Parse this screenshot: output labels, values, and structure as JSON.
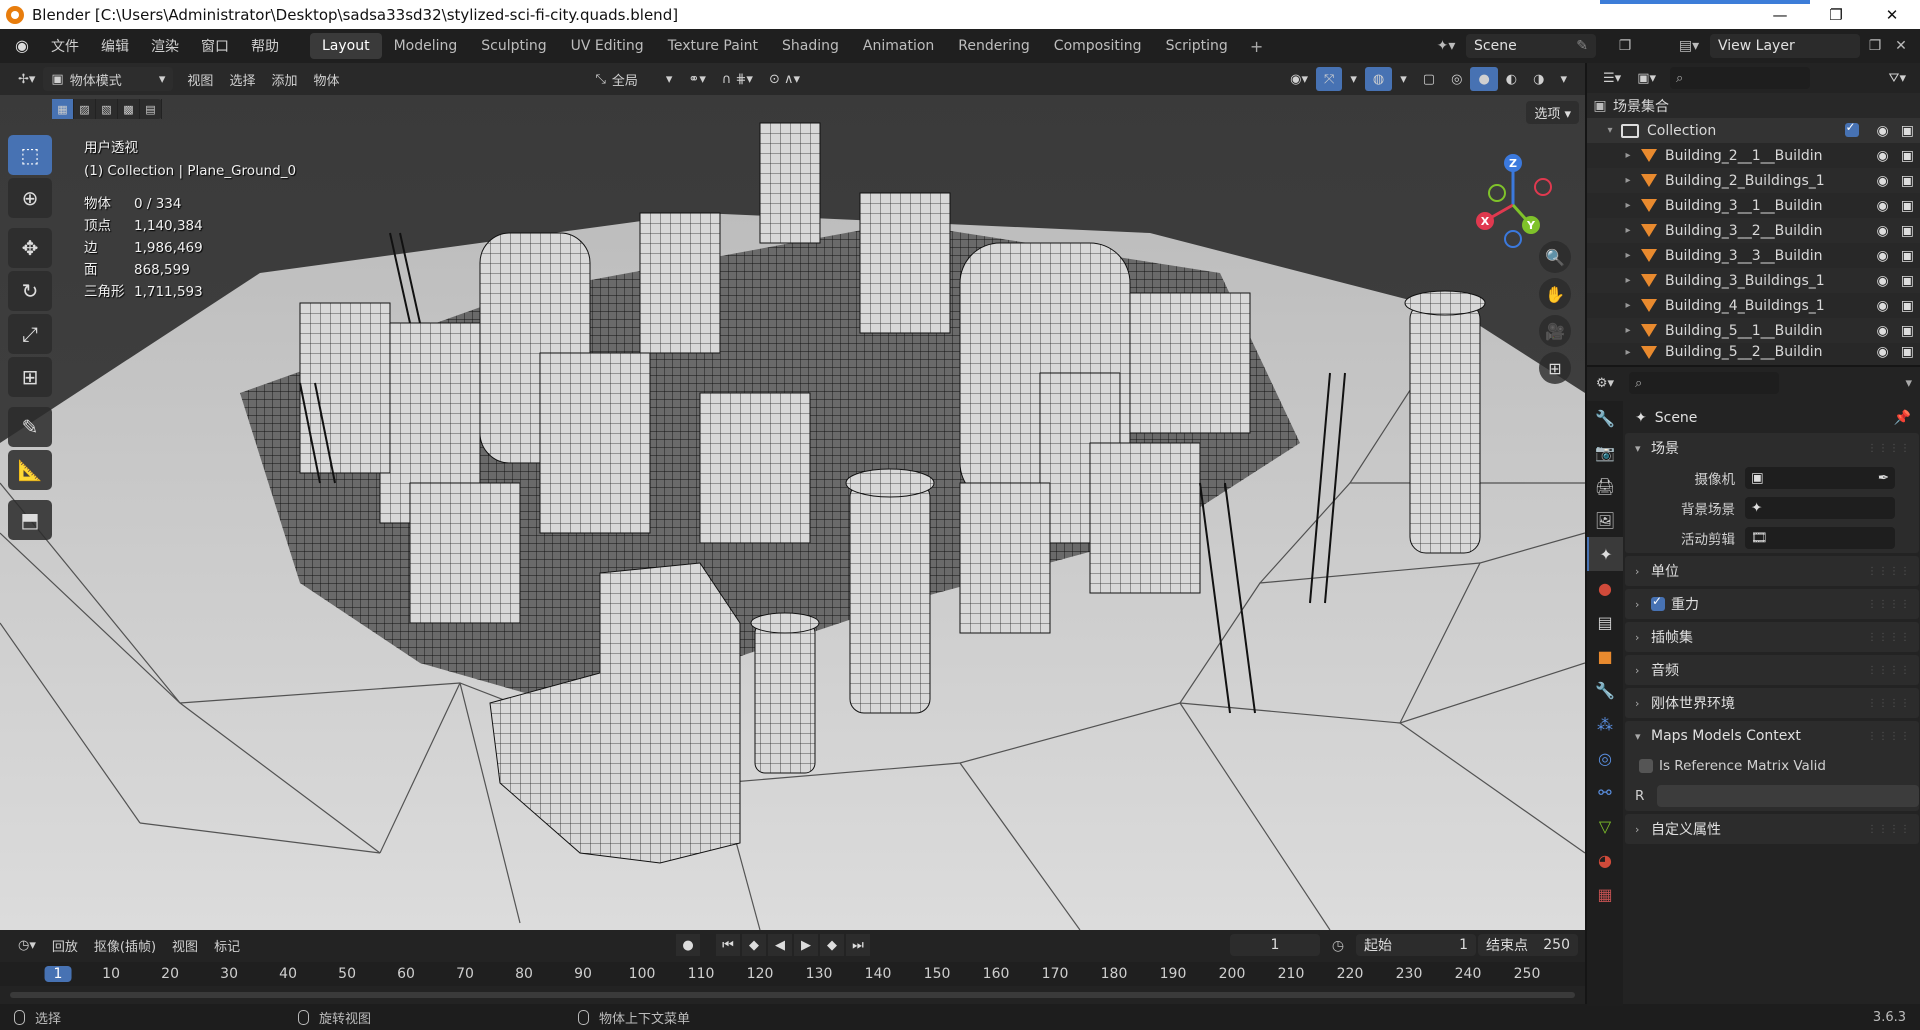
{
  "window": {
    "title": "Blender [C:\\Users\\Administrator\\Desktop\\sadsa33sd32\\stylized-sci-fi-city.quads.blend]",
    "controls": [
      "—",
      "❐",
      "✕"
    ]
  },
  "topmenu": {
    "items": [
      "文件",
      "编辑",
      "渲染",
      "窗口",
      "帮助"
    ],
    "workspaces": [
      "Layout",
      "Modeling",
      "Sculpting",
      "UV Editing",
      "Texture Paint",
      "Shading",
      "Animation",
      "Rendering",
      "Compositing",
      "Scripting"
    ],
    "active_workspace": "Layout",
    "add_label": "+",
    "scene": "Scene",
    "view_layer": "View Layer"
  },
  "viewport": {
    "mode": "物体模式",
    "menus": [
      "视图",
      "选择",
      "添加",
      "物体"
    ],
    "transform_orientation": "全局",
    "options_label": "选项",
    "view_name": "用户透视",
    "collection_info": "(1) Collection | Plane_Ground_0",
    "stats": [
      {
        "k": "物体",
        "v": "0 / 334"
      },
      {
        "k": "顶点",
        "v": "1,140,384"
      },
      {
        "k": "边",
        "v": "1,986,469"
      },
      {
        "k": "面",
        "v": "868,599"
      },
      {
        "k": "三角形",
        "v": "1,711,593"
      }
    ],
    "gizmo_axes": {
      "x": "X",
      "y": "Y",
      "z": "Z"
    },
    "axis_colors": {
      "x": "#e0394f",
      "y": "#7fc22a",
      "z": "#3b79dd"
    }
  },
  "timeline": {
    "menus": [
      "回放",
      "抠像(插帧)",
      "视图",
      "标记"
    ],
    "current_frame": "1",
    "start_label": "起始",
    "start": "1",
    "end_label": "结束点",
    "end": "250",
    "ticks": [
      "1",
      "10",
      "20",
      "30",
      "40",
      "50",
      "60",
      "70",
      "80",
      "90",
      "100",
      "110",
      "120",
      "130",
      "140",
      "150",
      "160",
      "170",
      "180",
      "190",
      "200",
      "210",
      "220",
      "230",
      "240",
      "250"
    ]
  },
  "statusbar": {
    "select": "选择",
    "rotate": "旋转视图",
    "context": "物体上下文菜单",
    "version": "3.6.3"
  },
  "outliner": {
    "root": "场景集合",
    "collection": "Collection",
    "items": [
      "Building_2__1__Buildin",
      "Building_2_Buildings_1",
      "Building_3__1__Buildin",
      "Building_3__2__Buildin",
      "Building_3__3__Buildin",
      "Building_3_Buildings_1",
      "Building_4_Buildings_1",
      "Building_5__1__Buildin",
      "Building_5__2__Buildin"
    ]
  },
  "properties": {
    "context": "Scene",
    "panels": {
      "scene": "场景",
      "camera": "摄像机",
      "background_scene": "背景场景",
      "active_clip": "活动剪辑",
      "units": "单位",
      "gravity": "重力",
      "keying_sets": "插帧集",
      "audio": "音频",
      "rigid_body": "刚体世界环境",
      "maps_models": "Maps Models Context",
      "ref_matrix": "Is Reference Matrix Valid",
      "r_label": "R",
      "custom_props": "自定义属性"
    }
  },
  "colors": {
    "accent": "#4772b3",
    "building_orange": "#e98a2e"
  }
}
